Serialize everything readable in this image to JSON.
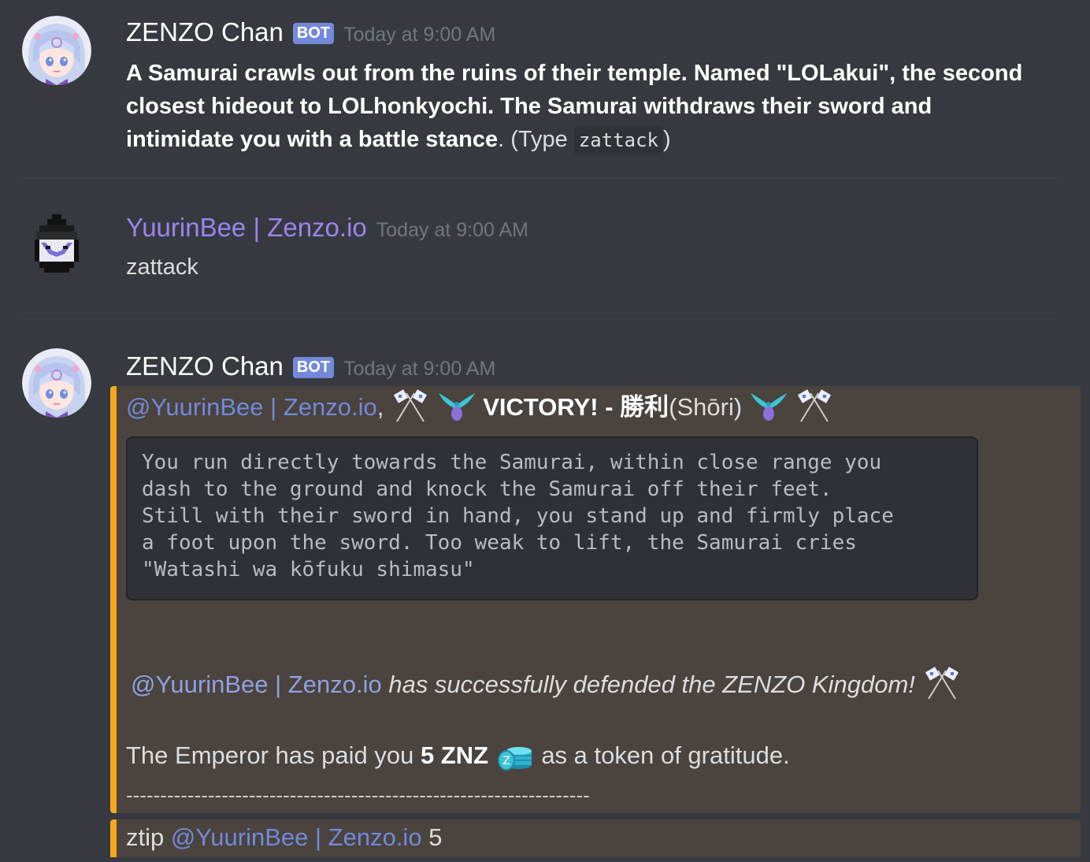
{
  "colors": {
    "background": "#36393f",
    "bot_tag": "#7289da",
    "mention": "#7289da",
    "embed_accent": "#faa61a",
    "embed_background": "#4a433e",
    "codeblock_background": "#2f3136",
    "timestamp": "#72767d",
    "username_purple": "#9b84ee"
  },
  "messages": [
    {
      "author": "ZENZO Chan",
      "bot_tag": "BOT",
      "timestamp": "Today at 9:00 AM",
      "avatar": "anime-girl-avatar-icon",
      "text_bold": "A Samurai crawls out from the ruins of their temple. Named \"LOLakui\", the second closest hideout to LOLhonkyochi. The Samurai withdraws their sword and intimidate you with a battle stance",
      "text_suffix_1": ". (Type ",
      "inline_code": "zattack",
      "text_suffix_2": ")"
    },
    {
      "author": "YuurinBee | Zenzo.io",
      "timestamp": "Today at 9:00 AM",
      "avatar": "pixel-bee-avatar-icon",
      "text": "zattack"
    },
    {
      "author": "ZENZO Chan",
      "bot_tag": "BOT",
      "timestamp": "Today at 9:00 AM",
      "avatar": "anime-girl-avatar-icon",
      "embed": {
        "mention": "@YuurinBee | Zenzo.io",
        "comma": ",",
        "victory_bold": "VICTORY! - 勝利",
        "victory_suffix": "(Shōri)",
        "codeblock": "You run directly towards the Samurai, within close range you\ndash to the ground and knock the Samurai off their feet.\nStill with their sword in hand, you stand up and firmly place\na foot upon the sword. Too weak to lift, the Samurai cries\n\"Watashi wa kōfuku shimasu\"",
        "defended_mention": "@YuurinBee | Zenzo.io",
        "defended_text": " has successfully defended the ZENZO Kingdom!",
        "paid_prefix": "The Emperor has paid you ",
        "paid_amount": "5 ZNZ",
        "paid_suffix": " as a token of gratitude.",
        "dashes": "--------------------------------------------------------------------"
      },
      "embed2": {
        "prefix": "ztip ",
        "mention": "@YuurinBee | Zenzo.io",
        "suffix": " 5"
      },
      "emoji_names": [
        "crossed-flags-icon",
        "phoenix-icon",
        "coin-stack-icon"
      ]
    }
  ]
}
